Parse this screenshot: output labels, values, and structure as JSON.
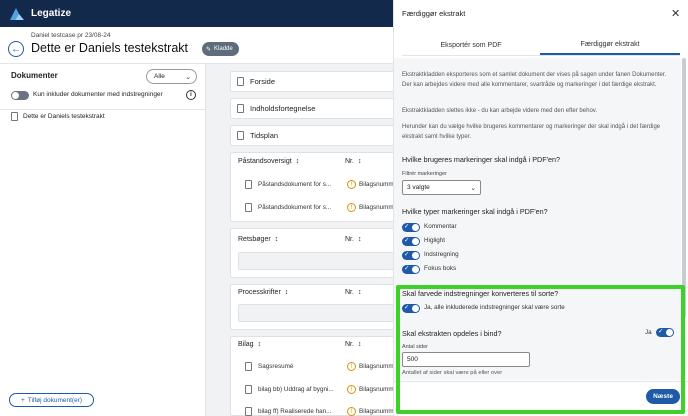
{
  "app": {
    "name": "Legatize"
  },
  "header": {
    "breadcrumb": "Daniel testcase pr 23/08-24",
    "title": "Dette er Daniels testekstrakt",
    "badge": "Kladde"
  },
  "documents": {
    "title": "Dokumenter",
    "filter_value": "Alle",
    "toggle_label": "Kun inkluder dokumenter med indstregninger",
    "items": [
      "Dette er Daniels testekstrakt"
    ],
    "add_button": "Tilføj dokument(er)"
  },
  "sections": {
    "forside": "Forside",
    "indhold": "Indholdsfortegnelse",
    "tidsplan": "Tidsplan",
    "paastand": {
      "title": "Påstandsoversigt",
      "nr": "Nr.",
      "rows": [
        {
          "name": "Påstandsdokument for s...",
          "nr": "Bilagsnumm"
        },
        {
          "name": "Påstandsdokument for s...",
          "nr": "Bilagsnumm"
        }
      ]
    },
    "retsboger": {
      "title": "Retsbøger",
      "nr": "Nr."
    },
    "processkrifter": {
      "title": "Processkrifter",
      "nr": "Nr."
    },
    "bilag": {
      "title": "Bilag",
      "nr": "Nr.",
      "rows": [
        {
          "name": "Sagsresumé",
          "nr": "Bilagsnumm"
        },
        {
          "name": "bilag bb) Uddrag af bygni...",
          "nr": "Bilagsnumm"
        },
        {
          "name": "bilag ff) Realiserede han...",
          "nr": "Bilagsnumm"
        }
      ]
    }
  },
  "drawer": {
    "title": "Færdiggør ekstrakt",
    "tabs": [
      "Eksportér som PDF",
      "Færdiggør ekstrakt"
    ],
    "active_tab": 1,
    "intro_1": "Ekstraktkladden eksporteres som et samlet dokument der vises på sagen under fanen Dokumenter. Der kan arbejdes videre med alle kommentarer, svartråde og markeringer i det færdige ekstrakt.",
    "intro_2": "Ekstraktkladden slettes ikke - du kan arbejde videre med den efter behov.",
    "intro_3": "Herunder kan du vælge hvilke brugeres kommentarer og markeringer der skal indgå i det færdige ekstrakt samt hvilke typer.",
    "q_users": "Hvilke brugeres markeringer skal indgå i PDF'en?",
    "filter_label": "Filtrér markeringer",
    "filter_value": "3 valgte",
    "q_types": "Hvilke typer markeringer skal indgå i PDF'en?",
    "types": [
      "Kommentar",
      "Higlight",
      "Indstregning",
      "Fokus boks"
    ],
    "q_convert": "Skal farvede indstregninger konverteres til sorte?",
    "convert_label": "Ja, alle inkluderede indstregninger skal være sorte",
    "q_split": "Skal ekstrakten opdeles i bind?",
    "split_label": "Ja",
    "pages_label": "Antal sider",
    "pages_value": "500",
    "pages_help": "Antallet af sider skal være på eller over",
    "next_button": "Næste"
  }
}
